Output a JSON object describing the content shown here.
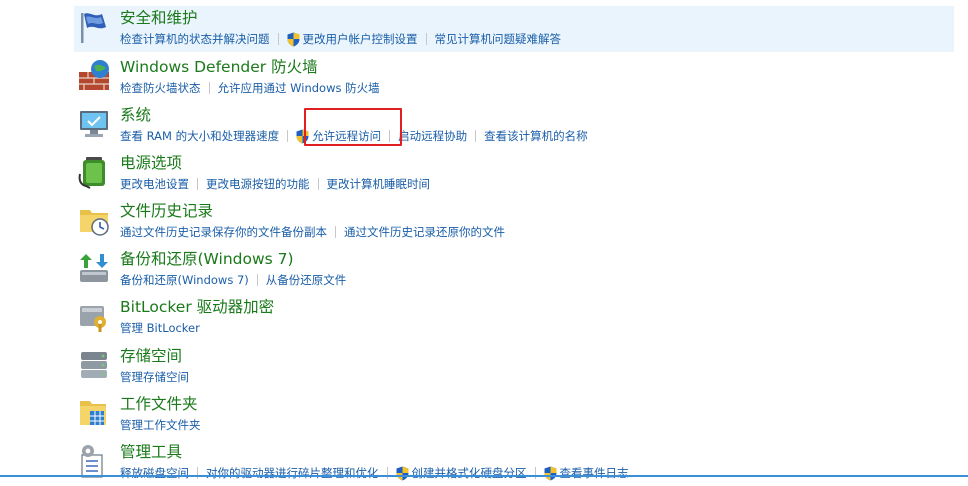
{
  "items": [
    {
      "title": "安全和维护",
      "icon": "flag-icon",
      "links": [
        {
          "label": "检查计算机的状态并解决问题",
          "shield": false
        },
        {
          "label": "更改用户帐户控制设置",
          "shield": true
        },
        {
          "label": "常见计算机问题疑难解答",
          "shield": false
        }
      ]
    },
    {
      "title": "Windows Defender 防火墙",
      "icon": "firewall-icon",
      "links": [
        {
          "label": "检查防火墙状态",
          "shield": false
        },
        {
          "label": "允许应用通过 Windows 防火墙",
          "shield": false
        }
      ]
    },
    {
      "title": "系统",
      "icon": "computer-icon",
      "links": [
        {
          "label": "查看 RAM 的大小和处理器速度",
          "shield": false
        },
        {
          "label": "允许远程访问",
          "shield": true
        },
        {
          "label": "启动远程协助",
          "shield": false
        },
        {
          "label": "查看该计算机的名称",
          "shield": false
        }
      ]
    },
    {
      "title": "电源选项",
      "icon": "battery-icon",
      "links": [
        {
          "label": "更改电池设置",
          "shield": false
        },
        {
          "label": "更改电源按钮的功能",
          "shield": false
        },
        {
          "label": "更改计算机睡眠时间",
          "shield": false
        }
      ]
    },
    {
      "title": "文件历史记录",
      "icon": "file-history-icon",
      "links": [
        {
          "label": "通过文件历史记录保存你的文件备份副本",
          "shield": false
        },
        {
          "label": "通过文件历史记录还原你的文件",
          "shield": false
        }
      ]
    },
    {
      "title": "备份和还原(Windows 7)",
      "icon": "backup-restore-icon",
      "links": [
        {
          "label": "备份和还原(Windows 7)",
          "shield": false
        },
        {
          "label": "从备份还原文件",
          "shield": false
        }
      ]
    },
    {
      "title": "BitLocker 驱动器加密",
      "icon": "bitlocker-icon",
      "links": [
        {
          "label": "管理 BitLocker",
          "shield": false
        }
      ]
    },
    {
      "title": "存储空间",
      "icon": "storage-spaces-icon",
      "links": [
        {
          "label": "管理存储空间",
          "shield": false
        }
      ]
    },
    {
      "title": "工作文件夹",
      "icon": "work-folders-icon",
      "links": [
        {
          "label": "管理工作文件夹",
          "shield": false
        }
      ]
    },
    {
      "title": "管理工具",
      "icon": "admin-tools-icon",
      "links": [
        {
          "label": "释放磁盘空间",
          "shield": false
        },
        {
          "label": "对你的驱动器进行碎片整理和优化",
          "shield": false
        },
        {
          "label": "创建并格式化硬盘分区",
          "shield": true
        },
        {
          "label": "查看事件日志",
          "shield": true
        }
      ]
    }
  ]
}
